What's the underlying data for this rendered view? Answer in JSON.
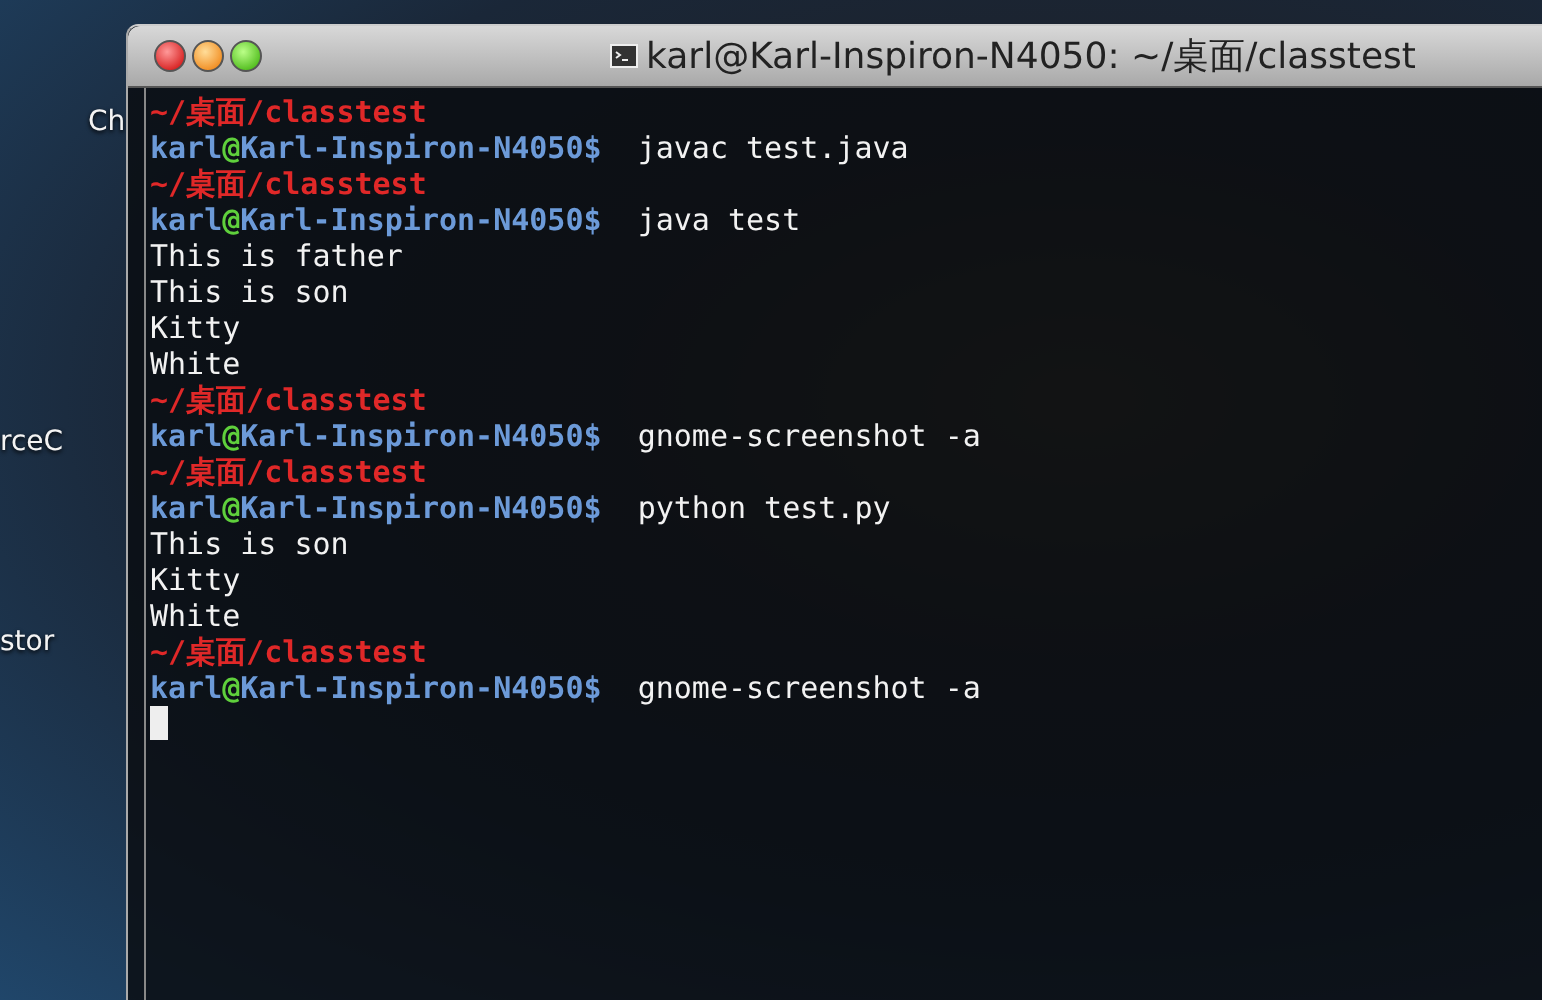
{
  "desktop": {
    "icons": [
      {
        "label": "Ch"
      },
      {
        "label": "rceC"
      },
      {
        "label": "stor"
      }
    ]
  },
  "window": {
    "title": "karl@Karl-Inspiron-N4050: ~/桌面/classtest",
    "lines": [
      {
        "kind": "path",
        "text": "~/桌面/classtest"
      },
      {
        "kind": "prompt",
        "user": "karl",
        "at": "@",
        "host": "Karl-Inspiron-N4050$",
        "command": "javac test.java"
      },
      {
        "kind": "path",
        "text": "~/桌面/classtest"
      },
      {
        "kind": "prompt",
        "user": "karl",
        "at": "@",
        "host": "Karl-Inspiron-N4050$",
        "command": "java test"
      },
      {
        "kind": "output",
        "text": "This is father"
      },
      {
        "kind": "output",
        "text": "This is son"
      },
      {
        "kind": "output",
        "text": "Kitty"
      },
      {
        "kind": "output",
        "text": "White"
      },
      {
        "kind": "path",
        "text": "~/桌面/classtest"
      },
      {
        "kind": "prompt",
        "user": "karl",
        "at": "@",
        "host": "Karl-Inspiron-N4050$",
        "command": "gnome-screenshot -a"
      },
      {
        "kind": "path",
        "text": "~/桌面/classtest"
      },
      {
        "kind": "prompt",
        "user": "karl",
        "at": "@",
        "host": "Karl-Inspiron-N4050$",
        "command": "python test.py"
      },
      {
        "kind": "output",
        "text": "This is son"
      },
      {
        "kind": "output",
        "text": "Kitty"
      },
      {
        "kind": "output",
        "text": "White"
      },
      {
        "kind": "path",
        "text": "~/桌面/classtest"
      },
      {
        "kind": "prompt",
        "user": "karl",
        "at": "@",
        "host": "Karl-Inspiron-N4050$",
        "command": "gnome-screenshot -a"
      },
      {
        "kind": "cursor"
      }
    ]
  }
}
